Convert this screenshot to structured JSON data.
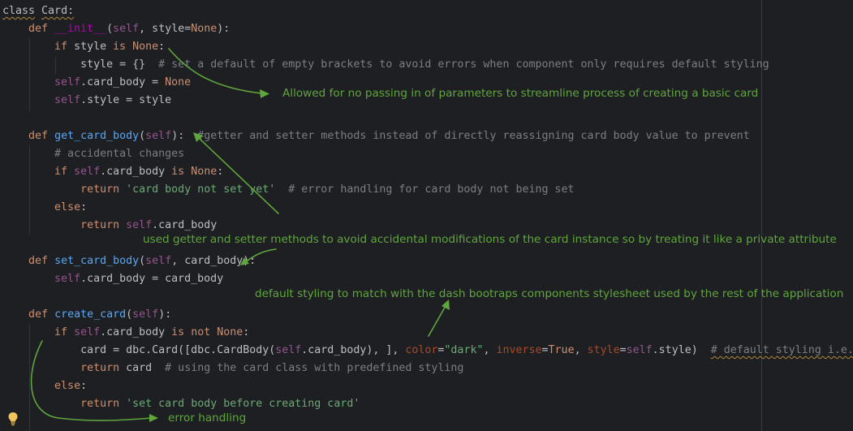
{
  "code": {
    "l1_class_kw": "class",
    "l1_class_name": "Card:",
    "l2_def": "def",
    "l2_fn": "__init__",
    "l2_open": "(",
    "l2_self": "self",
    "l2_rest": ", style=",
    "l2_none": "None",
    "l2_close": "):",
    "l3_if": "if",
    "l3_mid": " style ",
    "l3_is": "is",
    "l3_none": "None",
    "l3_colon": ":",
    "l4_assign": "style = {}  ",
    "l4_comment": "# set a default of empty brackets to avoid errors when component only requires default styling",
    "l5_self": "self",
    "l5_mid": ".card_body = ",
    "l5_none": "None",
    "l6_self": "self",
    "l6_mid": ".style = style",
    "l8_def": "def",
    "l8_fn": "get_card_body",
    "l8_open": "(",
    "l8_self": "self",
    "l8_close": "):  ",
    "l8_comment": "#getter and setter methods instead of directly reassigning card body value to prevent",
    "l9_comment": "# accidental changes",
    "l10_if": "if",
    "l10_self": "self",
    "l10_mid": ".card_body ",
    "l10_is": "is",
    "l10_none": "None",
    "l10_colon": ":",
    "l11_return": "return",
    "l11_str": "'card body not set yet'",
    "l11_comment": "  # error handling for card body not being set",
    "l12_else": "else",
    "l12_colon": ":",
    "l13_return": "return",
    "l13_self": "self",
    "l13_mid": ".card_body",
    "l15_def": "def",
    "l15_fn": "set_card_body",
    "l15_open": "(",
    "l15_self": "self",
    "l15_rest": ", card_body):",
    "l16_self": "self",
    "l16_mid": ".card_body = card_body",
    "l18_def": "def",
    "l18_fn": "create_card",
    "l18_open": "(",
    "l18_self": "self",
    "l18_close": "):",
    "l19_if": "if",
    "l19_self": "self",
    "l19_mid": ".card_body ",
    "l19_is": "is not",
    "l19_none": "None",
    "l19_colon": ":",
    "l20_a": "card = dbc.Card([dbc.CardBody(",
    "l20_self": "self",
    "l20_b": ".card_body), ], ",
    "l20_color": "color",
    "l20_eq1": "=",
    "l20_dark": "\"dark\"",
    "l20_c1": ", ",
    "l20_inverse": "inverse",
    "l20_eq2": "=",
    "l20_true": "True",
    "l20_c2": ", ",
    "l20_style": "style",
    "l20_eq3": "=",
    "l20_self2": "self",
    "l20_d": ".style)  ",
    "l20_comment": "# default styling i.e. dar",
    "l21_return": "return",
    "l21_mid": " card  ",
    "l21_comment": "# using the card class with predefined styling",
    "l22_else": "else",
    "l22_colon": ":",
    "l23_return": "return",
    "l23_str": "'set card body before creating card'"
  },
  "annotations": {
    "a1": "Allowed for no passing in of parameters to streamline process of creating a basic card",
    "a2": "used getter and setter methods to avoid accidental modifications of the card instance so by treating it like a private attribute",
    "a3": "default styling to match with the dash bootraps components stylesheet used by the rest of the application",
    "a4": "error handling"
  },
  "colors": {
    "background": "#1e1f22",
    "keyword": "#cf8e6d",
    "function": "#56a8f5",
    "string": "#6aab73",
    "comment": "#7a7e85",
    "self": "#94558d",
    "annotation": "#5fa63c"
  },
  "icons": {
    "gutter": "lightbulb-icon"
  }
}
